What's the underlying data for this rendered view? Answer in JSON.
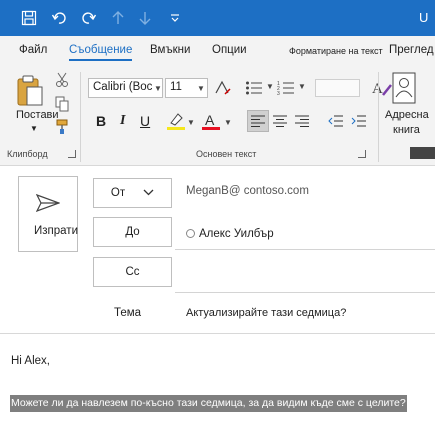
{
  "title_bar": {
    "title_fragment": "U",
    "background": "#1d6fc4",
    "quick_access": [
      "save-icon",
      "undo-icon",
      "redo-icon",
      "up-arrow-icon",
      "down-arrow-icon",
      "customize-icon"
    ]
  },
  "tabs": [
    {
      "label": "Файл",
      "active": false
    },
    {
      "label": "Съобщение",
      "active": true
    },
    {
      "label": "Вмъкни",
      "active": false
    },
    {
      "label": "Опции",
      "active": false
    },
    {
      "label": "Форматиране на текст",
      "active": false
    },
    {
      "label": "Преглед",
      "active": false
    }
  ],
  "ribbon": {
    "clipboard": {
      "paste_label": "Постави",
      "group_label": "Клипборд"
    },
    "basic_text": {
      "font_name": "Calibri (Boc",
      "font_size": "11",
      "bold": "B",
      "italic": "I",
      "underline": "U",
      "highlight_color": "#f5e71d",
      "font_color": "#e81123",
      "group_label": "Основен текст"
    },
    "names": {
      "address_book_line1": "Адресна",
      "address_book_line2": "книга"
    }
  },
  "compose": {
    "send_label": "Изпрати",
    "from_label": "От",
    "from_value": "MeganB@ contoso.com",
    "to_label": "До",
    "to_value": "Алекс Уилбър",
    "cc_label": "Cc",
    "subject_label": "Тема",
    "subject_value": "Актуализирайте тази седмица?"
  },
  "body": {
    "greeting": "Hi Alex,",
    "selected_text": "Можете ли да навлезем по-късно тази седмица, за да видим къде сме с целите?"
  }
}
